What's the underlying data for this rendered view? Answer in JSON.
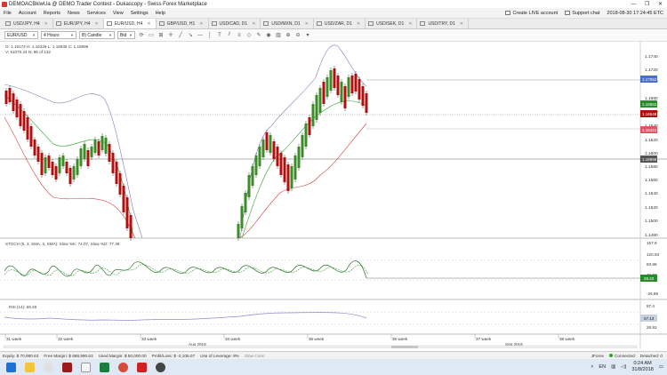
{
  "window": {
    "title": "DEMOACBkiwUa @ DEMO Trader Contest - Dukascopy - Swiss Forex Marketplace",
    "controls": [
      "—",
      "❐",
      "✕"
    ]
  },
  "menu": {
    "items": [
      "File",
      "Account",
      "Reports",
      "News",
      "Services",
      "View",
      "Settings",
      "Help"
    ],
    "create_live": "Create LIVE account",
    "support": "Support chat",
    "datetime": "2018-08-30 17:24:45 ETC"
  },
  "tabs": [
    {
      "label": "USD/JPY, H4",
      "active": false
    },
    {
      "label": "EUR/JPY, H4",
      "active": false
    },
    {
      "label": "EUR/USD, H4",
      "active": true
    },
    {
      "label": "GBP/USD, H1",
      "active": false
    },
    {
      "label": "USD/CAD, D1",
      "active": false
    },
    {
      "label": "USD/MXN, D1",
      "active": false
    },
    {
      "label": "USD/ZAR, D1",
      "active": false
    },
    {
      "label": "USD/SEK, D1",
      "active": false
    },
    {
      "label": "USD/TRY, D1",
      "active": false
    }
  ],
  "toolbar": {
    "instrument": "EUR/USD",
    "period": "4 Hours",
    "chart_type": "B) Candle",
    "price_side": "Bid"
  },
  "chart": {
    "ohlc_line": "O: 1.16174 H: 1.16229 L: 1.15939 C: 1.15999",
    "volume_line": "V: 51070.24 N: 95 of 132",
    "price_labels": [
      "1.1740",
      "1.1720",
      "1.1700",
      "1.1680",
      "1.1660",
      "1.1640",
      "1.1620",
      "1.1600",
      "1.1580",
      "1.1560",
      "1.1540",
      "1.1520",
      "1.1500",
      "1.1480"
    ],
    "tag_green": "1.16552",
    "tag_blue_top": "1.17052",
    "tag_red": "1.16548",
    "tag_pink": "1.16421",
    "tag_grey": "1.15999",
    "stoch_label": "STOCH (5, 3, SMA, 3, SMA): Slow %K: 74.07, Slow %D: 77.39",
    "stoch_axis": [
      "157.9",
      "120.93",
      "83.96",
      "46.98",
      "-26.96"
    ],
    "stoch_tag": "28.43",
    "rsi_label": "RSI (14): 69.29",
    "rsi_axis": [
      "87.4",
      "57.13",
      "26.92"
    ],
    "rsi_tag": "57.13",
    "week_labels": [
      "31 week",
      "32 week",
      "33 week",
      "34 week",
      "35 week",
      "36 week",
      "37 week",
      "38 week"
    ],
    "month_labels": [
      "Aug 2018",
      "Sep 2018"
    ],
    "colors": {
      "bull": "#3c8c28",
      "bear": "#b01010",
      "bb": "#7d7db8",
      "bb_lower": "#d04040",
      "mid": "#4caf50"
    }
  },
  "status": {
    "equity": "Equity: $ 70,990.63",
    "free_margin": "Free Margin: $ 668,990.63",
    "used_margin": "Used Margin: $ 50,000.00",
    "pnl": "Profit/Loss: $ -2,106.07",
    "leverage": "Use of Leverage: 8%",
    "mode": "Slow Conn",
    "connected": "Connected",
    "detached": "Detached: 0",
    "platform": "JForex"
  },
  "taskbar": {
    "lang": "EN",
    "time": "0:24 AM",
    "date": "31/8/2018"
  }
}
